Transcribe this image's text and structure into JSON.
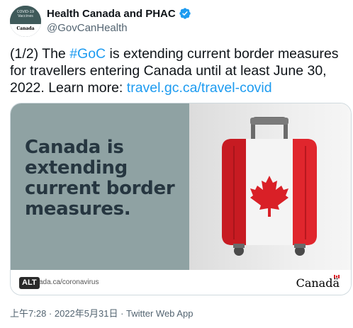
{
  "account": {
    "display_name": "Health Canada and PHAC",
    "handle": "@GovCanHealth",
    "avatar_text_top": "COVID-19 Vaccines",
    "avatar_text_bottom": "Canada"
  },
  "tweet": {
    "text_part1": "(1/2) The ",
    "hashtag": "#GoC",
    "text_part2": " is extending current border measures for travellers entering Canada until at least June 30, 2022. Learn more: ",
    "link": "travel.gc.ca/travel-covid"
  },
  "card": {
    "headline": "Canada is extending current border measures.",
    "alt_label": "ALT",
    "footer_url": "ada.ca/coronavirus",
    "wordmark": "Canadä"
  },
  "meta": {
    "timestamp": "上午7:28 · 2022年5月31日 · Twitter Web App"
  },
  "colors": {
    "link": "#1d9bf0",
    "panel": "#8fa2a3",
    "flag_red": "#e0262d"
  },
  "icons": [
    "verified-badge-icon",
    "maple-leaf-icon",
    "suitcase-image"
  ]
}
